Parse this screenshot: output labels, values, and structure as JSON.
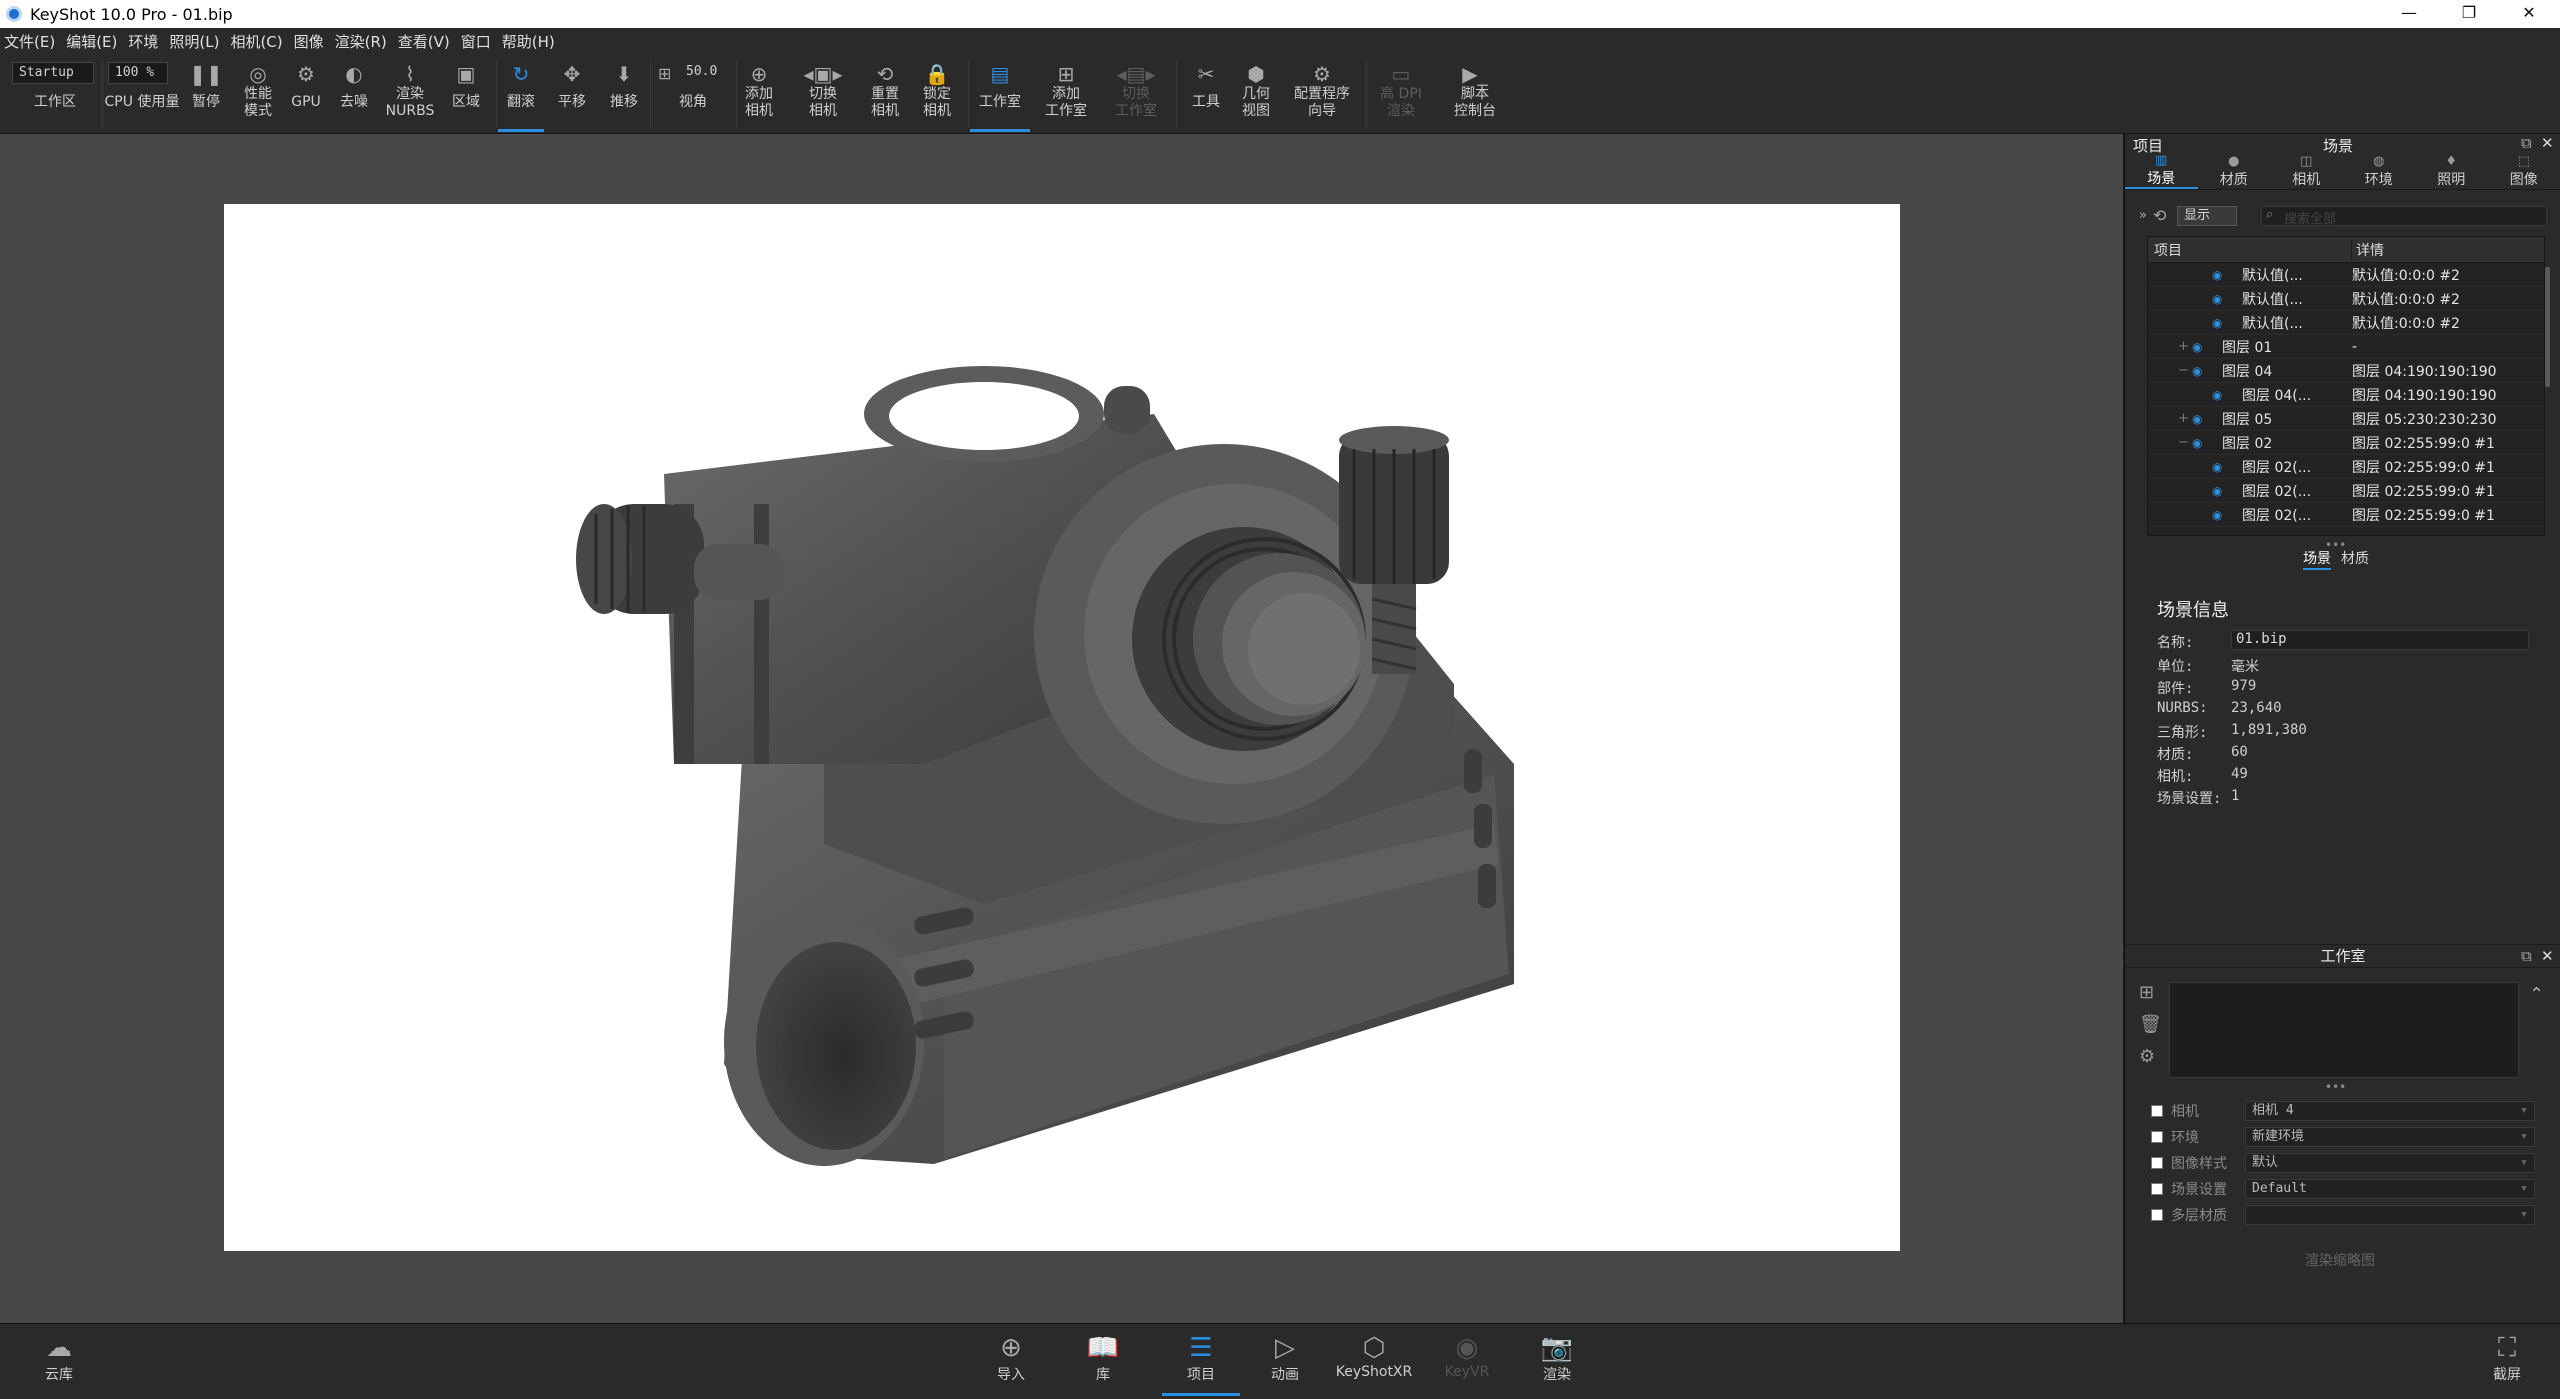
{
  "window": {
    "title": "KeyShot 10.0 Pro  - 01.bip",
    "minimize": "—",
    "maximize": "❐",
    "close": "✕"
  },
  "menu": [
    "文件(E)",
    "编辑(E)",
    "环境",
    "照明(L)",
    "相机(C)",
    "图像",
    "渲染(R)",
    "查看(V)",
    "窗口",
    "帮助(H)"
  ],
  "toolbar": {
    "workspace_value": "Startup",
    "workspace_label": "工作区",
    "cpu_value": "100 %",
    "cpu_label": "CPU 使用量",
    "pause": "暂停",
    "perf_mode": "性能\n模式",
    "gpu": "GPU",
    "denoise": "去噪",
    "render_nurbs": "渲染\nNURBS",
    "region": "区域",
    "tumble": "翻滚",
    "pan": "平移",
    "dolly": "推移",
    "fov_value": "50.0",
    "fov_label": "视角",
    "add_camera": "添加\n相机",
    "switch_camera": "切换\n相机",
    "reset_camera": "重置\n相机",
    "lock_camera": "锁定\n相机",
    "studio": "工作室",
    "add_studio": "添加\n工作室",
    "switch_studio": "切换\n工作室",
    "tools": "工具",
    "geometry_view": "几何\n视图",
    "config_wizard": "配置程序\n向导",
    "hidpi_render": "高 DPI\n渲染",
    "script_console": "脚本\n控制台"
  },
  "project_panel": {
    "left_title": "项目",
    "title": "场景",
    "tabs": [
      {
        "label": "场景",
        "icon": "scene-icon"
      },
      {
        "label": "材质",
        "icon": "material-icon"
      },
      {
        "label": "相机",
        "icon": "camera-icon"
      },
      {
        "label": "环境",
        "icon": "environment-icon"
      },
      {
        "label": "照明",
        "icon": "lighting-icon"
      },
      {
        "label": "图像",
        "icon": "image-icon"
      }
    ],
    "filter_label": "显示",
    "search_placeholder": "搜索全部",
    "columns": {
      "item": "项目",
      "detail": "详情"
    },
    "rows": [
      {
        "name": "默认值(...",
        "detail": "默认值:0:0:0 #2",
        "level": 3,
        "toggle": ""
      },
      {
        "name": "默认值(...",
        "detail": "默认值:0:0:0 #2",
        "level": 3,
        "toggle": ""
      },
      {
        "name": "默认值(...",
        "detail": "默认值:0:0:0 #2",
        "level": 3,
        "toggle": ""
      },
      {
        "name": "图层 01",
        "detail": "-",
        "level": 2,
        "toggle": "+"
      },
      {
        "name": "图层 04",
        "detail": "图层 04:190:190:190",
        "level": 2,
        "toggle": "−"
      },
      {
        "name": "图层 04(...",
        "detail": "图层 04:190:190:190",
        "level": 3,
        "toggle": ""
      },
      {
        "name": "图层 05",
        "detail": "图层 05:230:230:230",
        "level": 2,
        "toggle": "+"
      },
      {
        "name": "图层 02",
        "detail": "图层 02:255:99:0 #1",
        "level": 2,
        "toggle": "−"
      },
      {
        "name": "图层 02(...",
        "detail": "图层 02:255:99:0 #1",
        "level": 3,
        "toggle": ""
      },
      {
        "name": "图层 02(...",
        "detail": "图层 02:255:99:0 #1",
        "level": 3,
        "toggle": ""
      },
      {
        "name": "图层 02(...",
        "detail": "图层 02:255:99:0 #1",
        "level": 3,
        "toggle": ""
      }
    ],
    "subtabs": [
      "场景",
      "材质"
    ],
    "scene_info": {
      "title": "场景信息",
      "name_label": "名称:",
      "name_value": "01.bip",
      "rows": [
        {
          "label": "单位:",
          "value": "毫米"
        },
        {
          "label": "部件:",
          "value": "979"
        },
        {
          "label": "NURBS:",
          "value": "23,640"
        },
        {
          "label": "三角形:",
          "value": "1,891,380"
        },
        {
          "label": "材质:",
          "value": "60"
        },
        {
          "label": "相机:",
          "value": "49"
        },
        {
          "label": "场景设置:",
          "value": "1"
        }
      ]
    }
  },
  "studio_panel": {
    "title": "工作室",
    "rows": [
      {
        "label": "相机",
        "value": "相机 4"
      },
      {
        "label": "环境",
        "value": "新建环境"
      },
      {
        "label": "图像样式",
        "value": "默认"
      },
      {
        "label": "场景设置",
        "value": "Default"
      },
      {
        "label": "多层材质",
        "value": ""
      }
    ],
    "thumb_button": "渲染缩略图"
  },
  "bottombar": {
    "cloud": "云库",
    "import": "导入",
    "library": "库",
    "project": "项目",
    "animation": "动画",
    "keyshotxr": "KeyShotXR",
    "keyvr": "KeyVR",
    "render": "渲染",
    "screenshot": "截屏"
  },
  "colors": {
    "accent": "#2a8fe0",
    "panel": "#2a2a2a",
    "viewport": "#484848"
  }
}
